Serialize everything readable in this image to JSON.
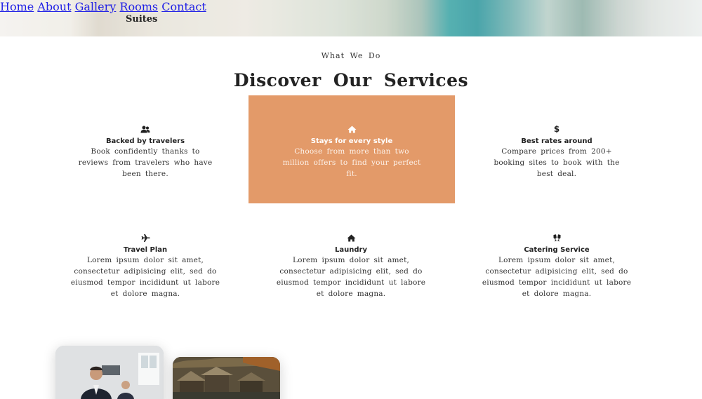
{
  "header": {
    "brand": "Suites",
    "nav": [
      {
        "label": "Home"
      },
      {
        "label": "About"
      },
      {
        "label": "Gallery"
      },
      {
        "label": "Rooms"
      },
      {
        "label": "Contact"
      }
    ]
  },
  "services": {
    "eyebrow": "What We Do",
    "title": "Discover Our Services",
    "accent_color": "#e39a69",
    "cards": [
      {
        "icon": "users-icon",
        "title": "Backed by travelers",
        "desc": "Book confidently thanks to reviews from travelers who have been there.",
        "active": false
      },
      {
        "icon": "house-icon",
        "title": "Stays for every style",
        "desc": "Choose from more than two million offers to find your perfect fit.",
        "active": true
      },
      {
        "icon": "dollar-icon",
        "title": "Best rates around",
        "desc": "Compare prices from 200+ booking sites to book with the best deal.",
        "active": false
      },
      {
        "icon": "plane-icon",
        "title": "Travel Plan",
        "desc": "Lorem ipsum dolor sit amet, consectetur adipisicing elit, sed do eiusmod tempor incididunt ut labore et dolore magna.",
        "active": false
      },
      {
        "icon": "house-icon",
        "title": "Laundry",
        "desc": "Lorem ipsum dolor sit amet, consectetur adipisicing elit, sed do eiusmod tempor incididunt ut labore et dolore magna.",
        "active": false
      },
      {
        "icon": "glasses-icon",
        "title": "Catering Service",
        "desc": "Lorem ipsum dolor sit amet, consectetur adipisicing elit, sed do eiusmod tempor incididunt ut labore et dolore magna.",
        "active": false
      }
    ]
  }
}
